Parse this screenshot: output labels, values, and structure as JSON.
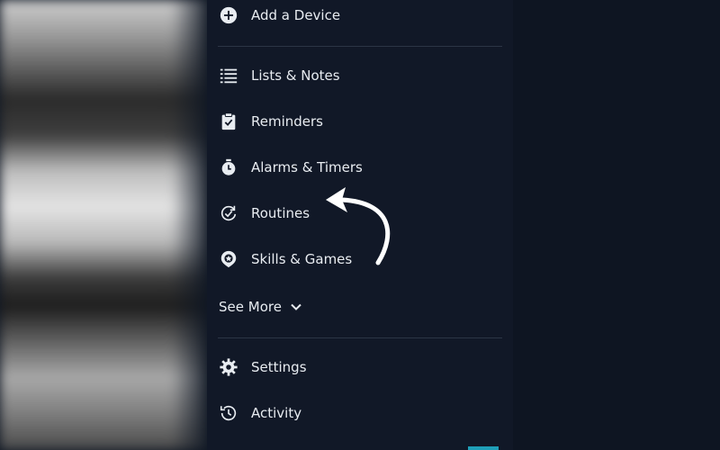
{
  "menu": {
    "add_device": "Add a Device",
    "items": [
      {
        "label": "Lists & Notes",
        "icon": "list-icon"
      },
      {
        "label": "Reminders",
        "icon": "reminder-clipboard-icon"
      },
      {
        "label": "Alarms & Timers",
        "icon": "alarm-clock-icon"
      },
      {
        "label": "Routines",
        "icon": "routines-icon"
      },
      {
        "label": "Skills & Games",
        "icon": "skills-icon"
      }
    ],
    "see_more": "See More",
    "footer_items": [
      {
        "label": "Settings",
        "icon": "gear-icon"
      },
      {
        "label": "Activity",
        "icon": "history-icon"
      }
    ]
  },
  "colors": {
    "menu_bg": "#111827",
    "text": "#e8ecf1",
    "divider": "#2c3545",
    "accent": "#1f9fb8"
  }
}
